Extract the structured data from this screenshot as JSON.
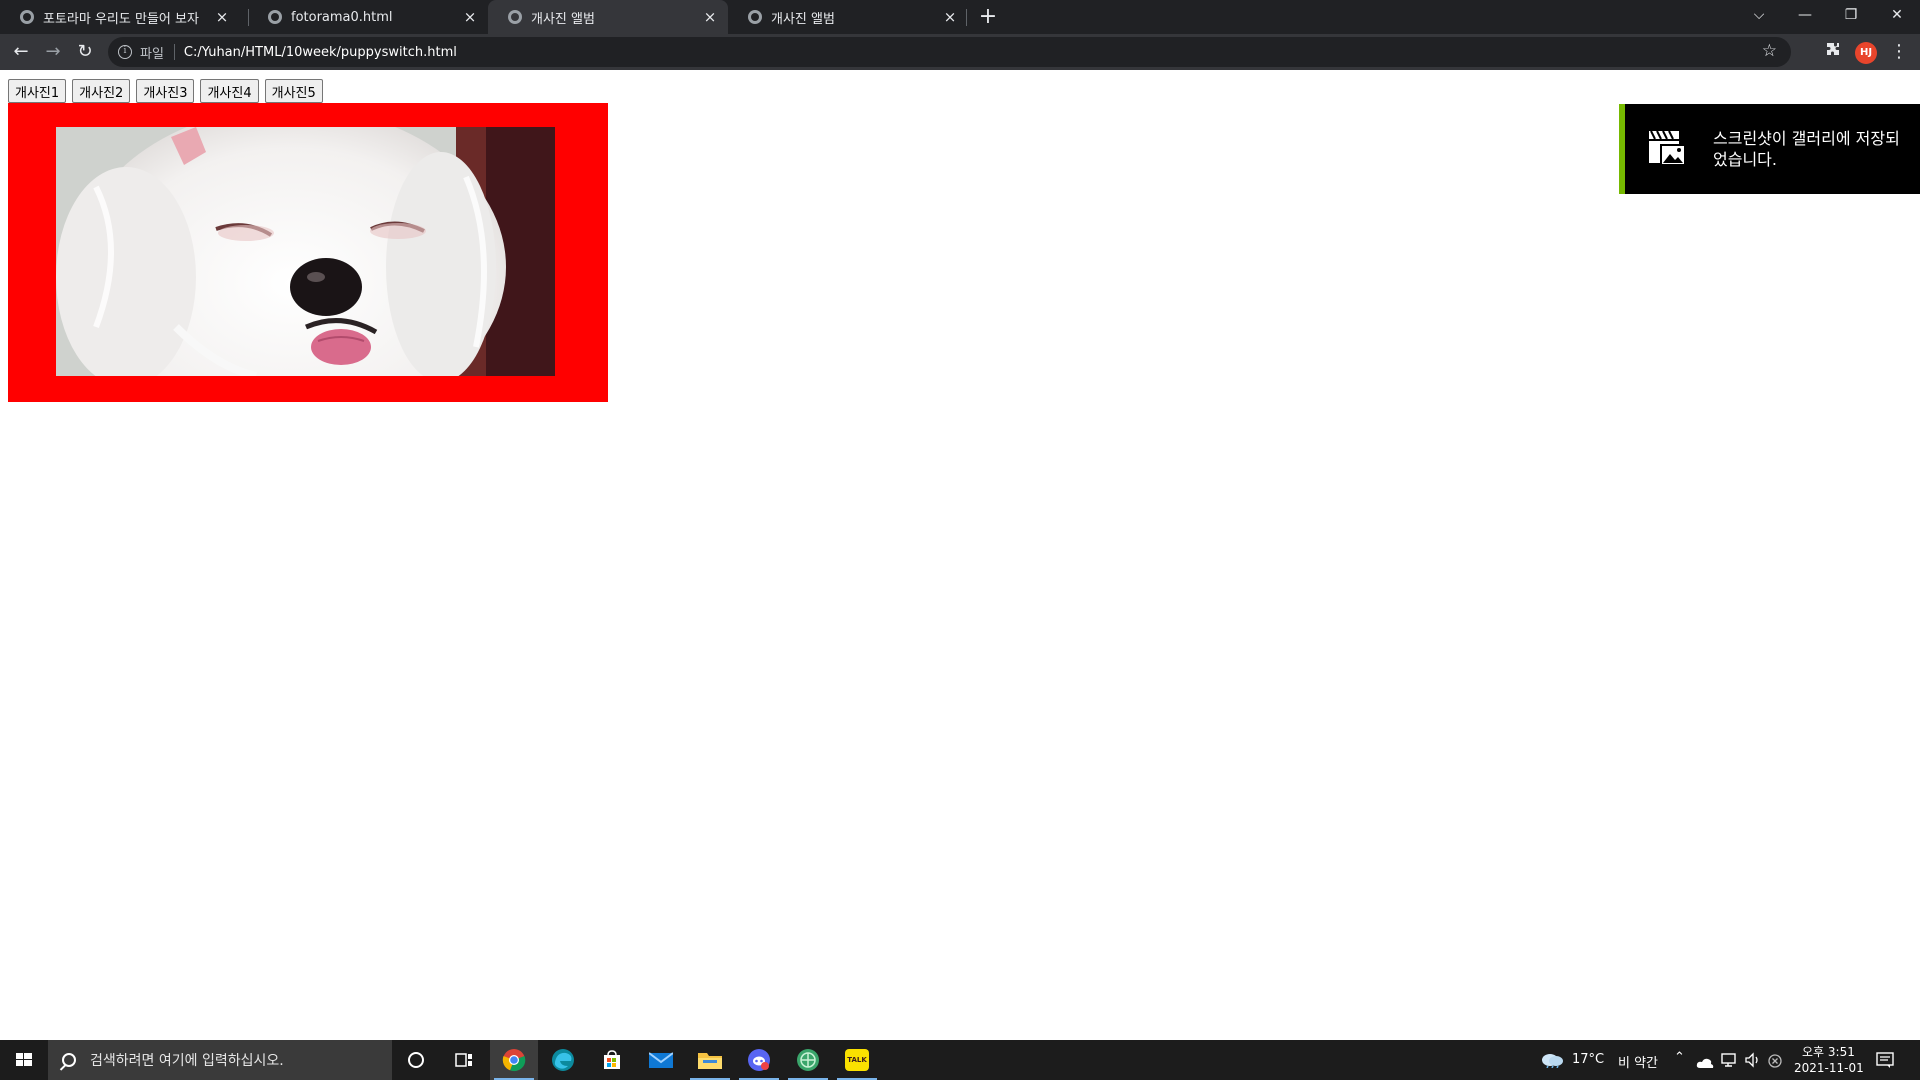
{
  "browser": {
    "tabs": [
      {
        "label": "포토라마 우리도 만들어 보자",
        "active": false
      },
      {
        "label": "fotorama0.html",
        "active": false
      },
      {
        "label": "개사진 앨범",
        "active": true
      },
      {
        "label": "개사진 앨범",
        "active": false
      }
    ],
    "tab_close_glyph": "×",
    "new_tab_glyph": "+",
    "window_controls": {
      "dropdown": "⌵",
      "minimize": "—",
      "restore": "❐",
      "close": "✕"
    },
    "address": {
      "scheme_label": "파일",
      "url": "C:/Yuhan/HTML/10week/puppyswitch.html"
    },
    "nav": {
      "back": "←",
      "forward": "→",
      "reload": "↻"
    },
    "profile_initials": "HJ",
    "icons": [
      "info-icon",
      "star-icon",
      "extensions-icon",
      "menu-icon"
    ]
  },
  "page": {
    "buttons": [
      "개사진1",
      "개사진2",
      "개사진3",
      "개사진4",
      "개사진5"
    ],
    "frame_color": "#ff0000",
    "photo_subject": "white-puppy-photo"
  },
  "toast": {
    "message": "스크린샷이 갤러리에 저장되었습니다.",
    "accent_color": "#76b900",
    "icon": "gallery-clapper-icon"
  },
  "taskbar": {
    "search_placeholder": "검색하려면 여기에 입력하십시오.",
    "apps": [
      "cortana-icon",
      "task-view-icon",
      "chrome-icon",
      "edge-icon",
      "store-icon",
      "mail-icon",
      "file-explorer-icon",
      "discord-icon",
      "network-app-icon",
      "kakaotalk-icon"
    ],
    "kakaotalk_label": "TALK",
    "weather": {
      "temp": "17°C",
      "condition": "비 약간"
    },
    "clock": {
      "time": "오후 3:51",
      "date": "2021-11-01"
    }
  }
}
